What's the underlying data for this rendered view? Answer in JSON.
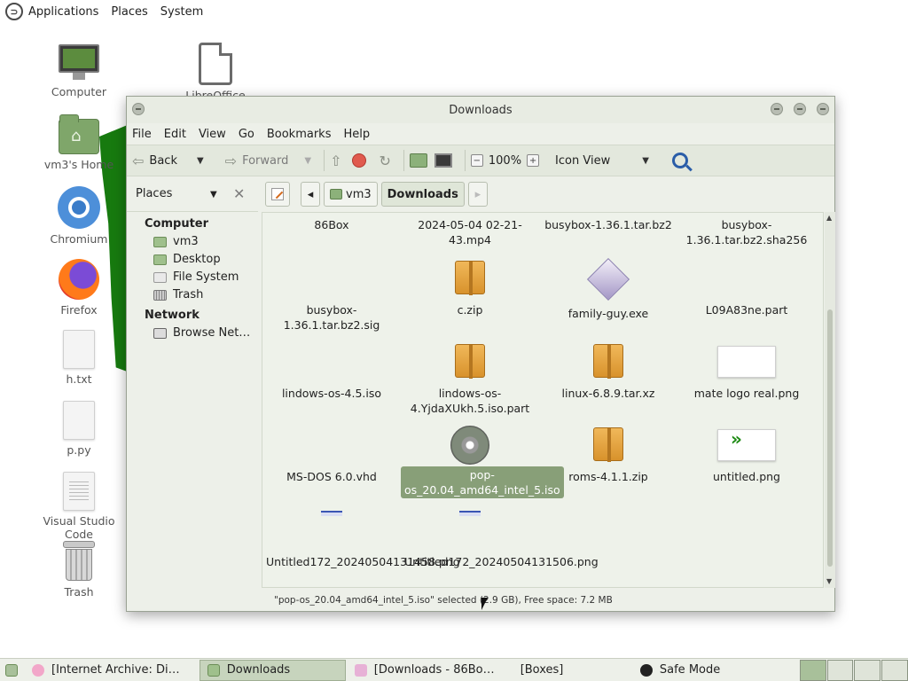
{
  "top_panel": {
    "menus": [
      "Applications",
      "Places",
      "System"
    ]
  },
  "desktop": {
    "icons": [
      {
        "label": "Computer"
      },
      {
        "label": "vm3's Home"
      },
      {
        "label": "Chromium"
      },
      {
        "label": "Firefox"
      },
      {
        "label": "h.txt"
      },
      {
        "label": "p.py"
      },
      {
        "label": "Visual Studio Code"
      },
      {
        "label": "Trash"
      },
      {
        "label": "LibreOffice"
      }
    ]
  },
  "window": {
    "title": "Downloads",
    "menubar": [
      "File",
      "Edit",
      "View",
      "Go",
      "Bookmarks",
      "Help"
    ],
    "toolbar": {
      "back": "Back",
      "forward": "Forward",
      "zoom": "100%",
      "view_mode": "Icon View"
    },
    "sidebar": {
      "header": "Places",
      "groups": [
        {
          "title": "Computer",
          "items": [
            "vm3",
            "Desktop",
            "File System",
            "Trash"
          ]
        },
        {
          "title": "Network",
          "items": [
            "Browse Net…"
          ]
        }
      ]
    },
    "pathbar": [
      "vm3",
      "Downloads"
    ],
    "files": [
      {
        "name": "86Box",
        "type": "blank"
      },
      {
        "name": "2024-05-04 02-21-43.mp4",
        "type": "blank"
      },
      {
        "name": "busybox-1.36.1.tar.bz2",
        "type": "blank"
      },
      {
        "name": "busybox-1.36.1.tar.bz2.sha256",
        "type": "blank"
      },
      {
        "name": "busybox-1.36.1.tar.bz2.sig",
        "type": "blank"
      },
      {
        "name": "c.zip",
        "type": "zip"
      },
      {
        "name": "family-guy.exe",
        "type": "exe"
      },
      {
        "name": "L09A83ne.part",
        "type": "blank"
      },
      {
        "name": "lindows-os-4.5.iso",
        "type": "blank"
      },
      {
        "name": "lindows-os-4.YjdaXUkh.5.iso.part",
        "type": "zip"
      },
      {
        "name": "linux-6.8.9.tar.xz",
        "type": "zip"
      },
      {
        "name": "mate logo real.png",
        "type": "png"
      },
      {
        "name": "MS-DOS 6.0.vhd",
        "type": "blank"
      },
      {
        "name": "pop-os_20.04_amd64_intel_5.iso",
        "type": "disc",
        "selected": true
      },
      {
        "name": "roms-4.1.1.zip",
        "type": "zip"
      },
      {
        "name": "untitled.png",
        "type": "png-logo"
      },
      {
        "name": "Untitled172_20240504131458.png",
        "type": "small"
      },
      {
        "name": "Untitled172_20240504131506.png",
        "type": "small"
      }
    ],
    "status": "\"pop-os_20.04_amd64_intel_5.iso\" selected (2.9 GB), Free space: 7.2 MB"
  },
  "taskbar": {
    "tasks": [
      {
        "label": "[Internet Archive: Di…"
      },
      {
        "label": "Downloads",
        "active": true
      },
      {
        "label": "[Downloads - 86Bo…"
      },
      {
        "label": "[Boxes]"
      },
      {
        "label": "Safe Mode"
      }
    ]
  },
  "colors": {
    "window_bg": "#edf0e9",
    "selection": "#889f78",
    "desktop_accent": "#177a0f"
  }
}
